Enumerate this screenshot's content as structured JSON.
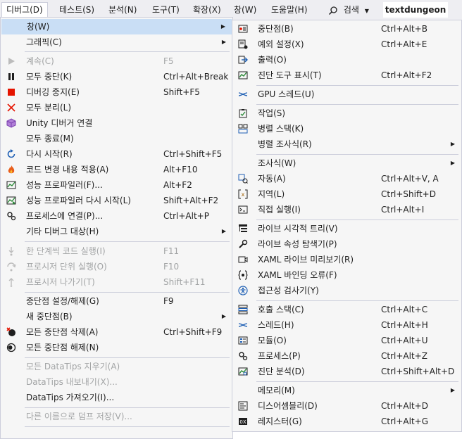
{
  "menubar": {
    "items": [
      "디버그(D)",
      "테스트(S)",
      "분석(N)",
      "도구(T)",
      "확장(X)",
      "창(W)",
      "도움말(H)"
    ],
    "search": "검색",
    "solution": "textdungeon"
  },
  "debug_menu": {
    "items": [
      {
        "label": "창(W)",
        "shortcut": "",
        "submenu": true,
        "icon": ""
      },
      {
        "label": "그래픽(C)",
        "shortcut": "",
        "submenu": true,
        "icon": ""
      },
      {
        "label": "계속(C)",
        "shortcut": "F5",
        "icon": "play-icon"
      },
      {
        "label": "모두 중단(K)",
        "shortcut": "Ctrl+Alt+Break",
        "icon": "pause-icon"
      },
      {
        "label": "디버깅 중지(E)",
        "shortcut": "Shift+F5",
        "icon": "stop-icon"
      },
      {
        "label": "모두 분리(L)",
        "shortcut": "",
        "icon": "detach-icon"
      },
      {
        "label": "Unity 디버거 연결",
        "shortcut": "",
        "icon": "unity-icon"
      },
      {
        "label": "모두 종료(M)",
        "shortcut": "",
        "icon": ""
      },
      {
        "label": "다시 시작(R)",
        "shortcut": "Ctrl+Shift+F5",
        "icon": "restart-icon"
      },
      {
        "label": "코드 변경 내용 적용(A)",
        "shortcut": "Alt+F10",
        "icon": "hot-reload-icon"
      },
      {
        "label": "성능 프로파일러(F)...",
        "shortcut": "Alt+F2",
        "icon": "profiler-icon"
      },
      {
        "label": "성능 프로파일러 다시 시작(L)",
        "shortcut": "Shift+Alt+F2",
        "icon": "profiler-restart-icon"
      },
      {
        "label": "프로세스에 연결(P)...",
        "shortcut": "Ctrl+Alt+P",
        "icon": "attach-process-icon"
      },
      {
        "label": "기타 디버그 대상(H)",
        "shortcut": "",
        "submenu": true,
        "icon": ""
      },
      {
        "label": "한 단계씩 코드 실행(I)",
        "shortcut": "F11",
        "icon": "step-into-icon"
      },
      {
        "label": "프로시저 단위 실행(O)",
        "shortcut": "F10",
        "icon": "step-over-icon"
      },
      {
        "label": "프로시저 나가기(T)",
        "shortcut": "Shift+F11",
        "icon": "step-out-icon"
      },
      {
        "label": "중단점 설정/해제(G)",
        "shortcut": "F9",
        "icon": ""
      },
      {
        "label": "새 중단점(B)",
        "shortcut": "",
        "submenu": true,
        "icon": ""
      },
      {
        "label": "모든 중단점 삭제(A)",
        "shortcut": "Ctrl+Shift+F9",
        "icon": "delete-breakpoints-icon"
      },
      {
        "label": "모든 중단점 해제(N)",
        "shortcut": "",
        "icon": "disable-breakpoints-icon"
      },
      {
        "label": "모든 DataTips 지우기(A)",
        "shortcut": "",
        "icon": ""
      },
      {
        "label": "DataTips 내보내기(X)...",
        "shortcut": "",
        "icon": ""
      },
      {
        "label": "DataTips 가져오기(I)...",
        "shortcut": "",
        "icon": ""
      },
      {
        "label": "다른 이름으로 덤프 저장(V)...",
        "shortcut": "",
        "icon": ""
      }
    ]
  },
  "windows_submenu": {
    "items": [
      {
        "label": "중단점(B)",
        "shortcut": "Ctrl+Alt+B",
        "icon": "breakpoints-window-icon"
      },
      {
        "label": "예외 설정(X)",
        "shortcut": "Ctrl+Alt+E",
        "icon": "exception-settings-icon"
      },
      {
        "label": "출력(O)",
        "shortcut": "",
        "icon": "output-icon"
      },
      {
        "label": "진단 도구 표시(T)",
        "shortcut": "Ctrl+Alt+F2",
        "icon": "diagnostic-tools-icon"
      },
      {
        "label": "GPU 스레드(U)",
        "shortcut": "",
        "icon": "gpu-threads-icon"
      },
      {
        "label": "작업(S)",
        "shortcut": "",
        "icon": "tasks-icon"
      },
      {
        "label": "병렬 스택(K)",
        "shortcut": "",
        "icon": "parallel-stacks-icon"
      },
      {
        "label": "병렬 조사식(R)",
        "shortcut": "",
        "submenu": true,
        "icon": ""
      },
      {
        "label": "조사식(W)",
        "shortcut": "",
        "submenu": true,
        "icon": ""
      },
      {
        "label": "자동(A)",
        "shortcut": "Ctrl+Alt+V, A",
        "icon": "autos-icon"
      },
      {
        "label": "지역(L)",
        "shortcut": "Ctrl+Shift+D",
        "icon": "locals-icon"
      },
      {
        "label": "직접 실행(I)",
        "shortcut": "Ctrl+Alt+I",
        "icon": "immediate-icon"
      },
      {
        "label": "라이브 시각적 트리(V)",
        "shortcut": "",
        "icon": "live-visual-tree-icon"
      },
      {
        "label": "라이브 속성 탐색기(P)",
        "shortcut": "",
        "icon": "live-property-explorer-icon"
      },
      {
        "label": "XAML 라이브 미리보기(R)",
        "shortcut": "",
        "icon": "xaml-preview-icon"
      },
      {
        "label": "XAML 바인딩 오류(F)",
        "shortcut": "",
        "icon": "xaml-binding-icon"
      },
      {
        "label": "접근성 검사기(Y)",
        "shortcut": "",
        "icon": "accessibility-icon"
      },
      {
        "label": "호출 스택(C)",
        "shortcut": "Ctrl+Alt+C",
        "icon": "call-stack-icon"
      },
      {
        "label": "스레드(H)",
        "shortcut": "Ctrl+Alt+H",
        "icon": "threads-icon"
      },
      {
        "label": "모듈(O)",
        "shortcut": "Ctrl+Alt+U",
        "icon": "modules-icon"
      },
      {
        "label": "프로세스(P)",
        "shortcut": "Ctrl+Alt+Z",
        "icon": "processes-icon"
      },
      {
        "label": "진단 분석(D)",
        "shortcut": "Ctrl+Shift+Alt+D",
        "icon": "diagnostics-analysis-icon"
      },
      {
        "label": "메모리(M)",
        "shortcut": "",
        "submenu": true,
        "icon": ""
      },
      {
        "label": "디스어셈블리(D)",
        "shortcut": "Ctrl+Alt+D",
        "icon": "disassembly-icon"
      },
      {
        "label": "레지스터(G)",
        "shortcut": "Ctrl+Alt+G",
        "icon": "registers-icon"
      }
    ]
  },
  "colors": {
    "menubar_bg": "#eeeef2",
    "menu_bg": "#f6f6f6",
    "highlight": "#c9def5",
    "disabled_text": "#a2a4a5",
    "separator": "#cccedb",
    "accent_blue": "#1e5fb4",
    "stop_red": "#e51400"
  }
}
